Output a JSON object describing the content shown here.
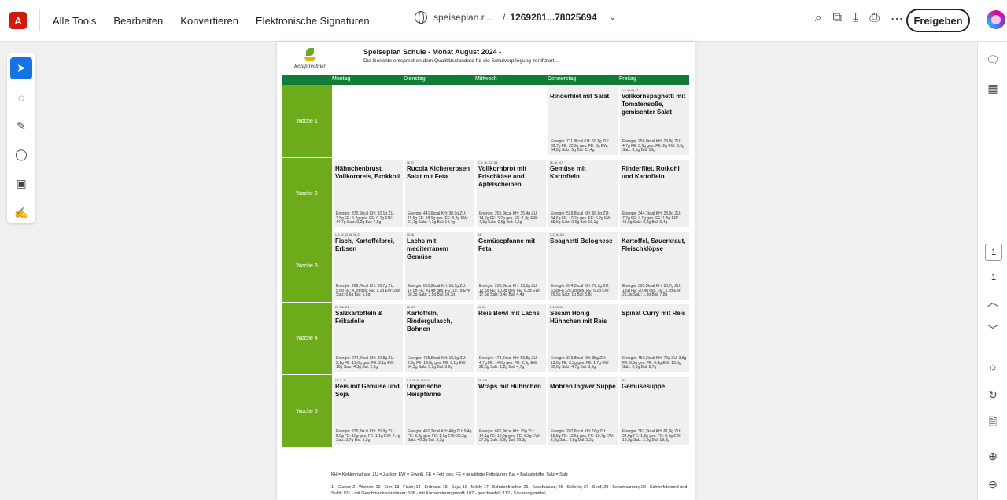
{
  "toolbar": {
    "logo": "A",
    "menu": [
      "Alle Tools",
      "Bearbeiten",
      "Konvertieren",
      "Elektronische Signaturen"
    ],
    "doc_name": "speiseplan.r...",
    "doc_sep": "/",
    "doc_id": "1269281...78025694",
    "share_label": "Freigeben",
    "accent": "#1473e6"
  },
  "sidebar": {
    "page_current": "1",
    "page_total": "1"
  },
  "pdf": {
    "title": "Speiseplan Schule - Monat August 2024 -",
    "subtitle": "Die Gerichte entsprechen dem Qualitätsstandard für die Schulverpflegung zertifiziert ...",
    "brand": "Rezeptrechner",
    "days": [
      "Montag",
      "Dienstag",
      "Mittwoch",
      "Donnerstag",
      "Freitag"
    ],
    "weeks": [
      "Woche 1",
      "Woche 2",
      "Woche 3",
      "Woche 4",
      "Woche 5"
    ],
    "w1": [
      {
        "codes": "",
        "dish": "Rinderfilet mit Salat",
        "nut": "Energie: 711,8kcal KH: 60,1g ZU: 39,7g FE: 20,9g ges. FE: 3g EW: 64,8g Salz: 5g Bal: 11,4g"
      },
      {
        "codes": "1, 2, 16, 26, 27",
        "dish": "Vollkornspaghetti mit Tomatensoße, gemischter Salat",
        "nut": "Energie: 256,0kcal KH: 29,8g ZU: 4,7g FE: 8,6g ges. FE: 2g EW: 9,9g Salz: 0,5g Bal: 10g"
      }
    ],
    "w2": [
      {
        "codes": "",
        "dish": "Hähnchenbrust, Vollkornreis, Brokkoli",
        "nut": "Energie: 370,5kcal KH: 32,1g ZU: 3,5g FE: 5,2g ges. FE: 0,7g EW: 44,7g Salz: 0,2g Bal: 7,5g"
      },
      {
        "codes": "16, 27",
        "dish": "Rucola Kichererbsen Salat mit Feta",
        "nut": "Energie: 441,6kcal KH: 38,9g ZU: 11,6g FE: 18,9g ges. FE: 9,3g EW: 21,7g Salz: 4,1g Bal: 14,4g"
      },
      {
        "codes": "1, 2, 16, 112, 116",
        "dish": "Vollkornbrot mit Frischkäse und Apfelscheiben",
        "nut": "Energie: 201,0kcal KH: 35,4g ZU: 14,2g FE: 3,2g ges. FE: 1,8g EW: 4,3g Salz: 0,6g Bal: 6,6g"
      },
      {
        "codes": "16, 26, 107",
        "dish": "Gemüse mit Kartoffeln",
        "nut": "Energie: 539,8kcal KH: 66,8g ZU: 34,6g FE: 10,2g ges. FE: 5,2g EW: 35,5g Salz: 0,6g Bal: 16,1g"
      },
      {
        "codes": "",
        "dish": "Rinderfilet, Rotkohl und Kartoffeln",
        "nut": "Energie: 344,7kcal KH: 23,9g ZU: 7,2g FE: 7,1g ges. FE: 1,5g EW: 41,6g Salz: 0,2g Bal: 9,4g"
      }
    ],
    "w3": [
      {
        "codes": "1, 2, 12, 13, 16, 26, 27",
        "dish": "Fisch, Kartoffelbrei, Erbsen",
        "nut": "Energie: 269,7kcal KH: 26,7g ZU: 5,6g FE: 4,2g ges. FE: 1,1g EW: 28g Salz: 0,6g Bal: 6,5g"
      },
      {
        "codes": "13, 16",
        "dish": "Lachs mit mediterranem Gemüse",
        "nut": "Energie: 661,2kcal KH: 16,5g ZU: 14,5g FE: 41,4g ges. FE: 19,7g EW: 50,3g Salz: 3,5g Bal: 10,3g"
      },
      {
        "codes": "16",
        "dish": "Gemüsepfanne mit Feta",
        "nut": "Energie: 230,8kcal KH: 13,5g ZU: 12,5g FE: 10,9g ges. FE: 6,3g EW: 17,5g Salz: 3,4g Bal: 4,4g"
      },
      {
        "codes": "1, 2, 16, 106",
        "dish": "Spaghetti Bolognese",
        "nut": "Energie: 674,5kcal KH: 79,7g ZU: 6,5g FE: 25,1g ges. FE: 6,2g EW: 29,5g Salz: 1g Bal: 5,8g"
      },
      {
        "codes": "",
        "dish": "Kartoffel, Sauerkraut, Fleischklöpse",
        "nut": "Energie: 395,5kcal KH: 23,7g ZU: 1,6g FE: 20,4g ges. FE: 3,2g EW: 25,3g Salz: 1,9g Bal: 7,8g"
      }
    ],
    "w4": [
      {
        "codes": "27, 106, 112",
        "dish": "Salzkartoffeln & Frikadelle",
        "nut": "Energie: 274,2kcal KH: 22,8g ZU: 2,1g FE: 12,6g ges. FE: 2,1g EW: 16g Salz: 4,3g Bal: 2,9g"
      },
      {
        "codes": "26, 107",
        "dish": "Kartoffeln, Rindergulasch, Bohnen",
        "nut": "Energie: 405,5kcal KH: 18,9g ZU: 2,9g FE: 19,8g ges. FE: 6,1g EW: 34,3g Salz: 0,3g Bal: 5,6g"
      },
      {
        "codes": "13, 26",
        "dish": "Reis Bowl mit Lachs",
        "nut": "Energie: 473,6kcal KH: 53,8g ZU: 4,7g FE: 14,6g ges. FE: 2,9g EW: 28,5g Salz: 1,2g Bal: 4,7g"
      },
      {
        "codes": "1, 2, 15, 26",
        "dish": "Sesam Honig Hühnchen mit Reis",
        "nut": "Energie: 373,8kcal KH: 35g ZU: 12,8g FE: 9,3g ges. FE: 1,7g EW: 35,6g Salz: 4,7g Bal: 3,9g"
      },
      {
        "codes": "",
        "dish": "Spinat Curry mit Reis",
        "nut": "Energie: 459,3kcal KH: 72g ZU: 3,8g FE: 8,5g ges. FE: 0,4g EW: 19,5g Salz: 0,5g Bal: 8,7g"
      }
    ],
    "w5": [
      {
        "codes": "13, 11, 21",
        "dish": "Reis mit Gemüse und Soja",
        "nut": "Energie: 230,2kcal KH: 25,9g ZU: 5,9g FE: 10g ges. FE: 1,1g EW: 7,4g Salz: 3,7g Bal: 3,3g"
      },
      {
        "codes": "1, 2, 16, 26, 101, 114",
        "dish": "Ungarische Reispfanne",
        "nut": "Energie: 410,2kcal KH: 48g ZU: 9,4g FE: 8,2g ges. FE: 1,1g EW: 30,3g Salz: 46,3g Bal: 9,3g"
      },
      {
        "codes": "16, 128",
        "dish": "Wraps mit Hühnchen",
        "nut": "Energie: 662,9kcal KH: 75g ZU: 14,1g FE: 19,9g ges. FE: 6,3g EW: 37,9g Salz: 2,9g Bal: 16,3g"
      },
      {
        "codes": "",
        "dish": "Möhren Ingwer Suppe",
        "nut": "Energie: 207,6kcal KH: 18g ZU: 15,5g FE: 12,5g ges. FE: 10,7g EW: 2,9g Salz: 0,8g Bal: 5,5g"
      },
      {
        "codes": "26",
        "dish": "Gemüsesuppe",
        "nut": "Energie: 363,2kcal KH: 61,9g ZU: 24,9g FE: 1,8g ges. FE: 0,4g EW: 15,3g Salz: 2,3g Bal: 19,3g"
      }
    ],
    "legend1": "KH = Kohlenhydrate, ZU = Zucker, EW = Eiweiß, FE = Fett, ges. FE = gesättigte Fettsäuren, Bal = Ballaststoffe, Salz = Salz",
    "legend2": "1 - Gluten; 2 - Weizen; 12 - Eier; 13 - Fisch; 14 - Erdnuss; 15 - Soja; 16 - Milch; 17 - Schalenfrüchte; 21 - Kaschunuss; 26 - Sellerie; 27 - Senf; 28 - Sesamsamen; 29 - Schwefeldioxid und Sulfit; 101 - mit Geschmacksverstärker; 106 - mit Konservierungsstoff; 107 - geschwefelt; 112 - Säuerungsmittel;"
  }
}
